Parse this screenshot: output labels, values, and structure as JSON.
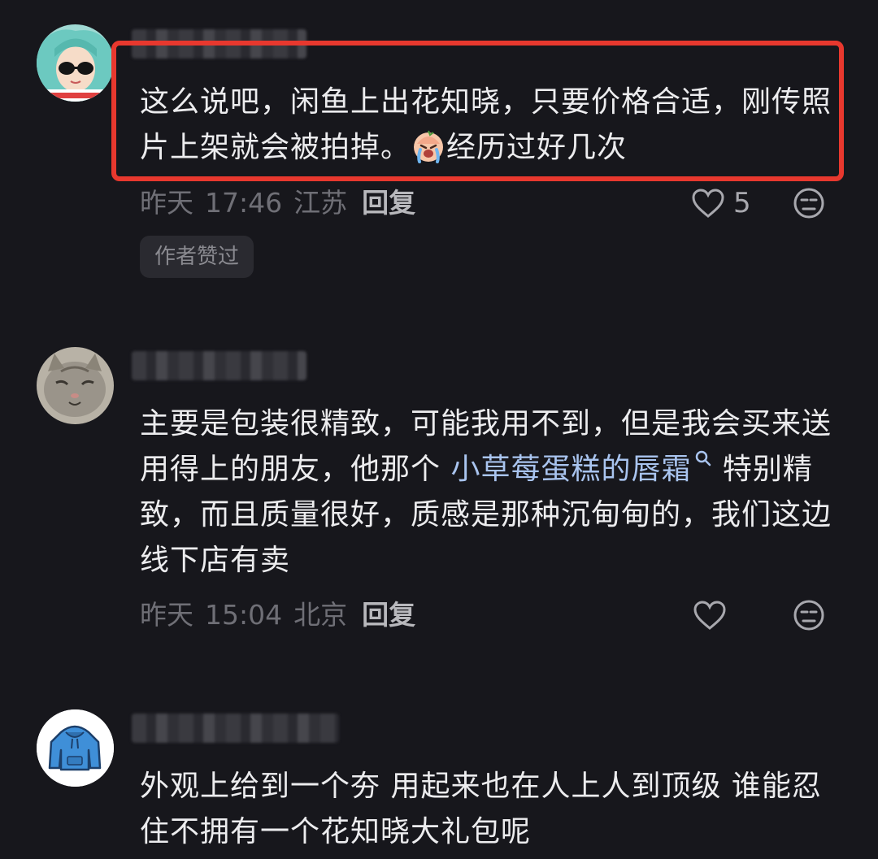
{
  "comments": [
    {
      "text": "这么说吧，闲鱼上出花知晓，只要价格合适，刚传照片上架就会被拍掉。",
      "text_after_emoji": "经历过好几次",
      "date": "昨天",
      "time": "17:46",
      "location": "江苏",
      "reply_label": "回复",
      "like_count": "5",
      "badge": "作者赞过",
      "emoji": "crying-face-emoji"
    },
    {
      "text_before_link": "主要是包装很精致，可能我用不到，但是我会买来送用得上的朋友，他那个 ",
      "link_text": "小草莓蛋糕的唇霜",
      "text_after_link": " 特别精致，而且质量很好，质感是那种沉甸甸的，我们这边线下店有卖",
      "date": "昨天",
      "time": "15:04",
      "location": "北京",
      "reply_label": "回复"
    },
    {
      "text": "外观上给到一个夯 用起来也在人上人到顶级 谁能忍住不拥有一个花知晓大礼包呢"
    }
  ],
  "colors": {
    "background": "#17171c",
    "highlight_border": "#e8382e",
    "link": "#a9c4ef"
  }
}
